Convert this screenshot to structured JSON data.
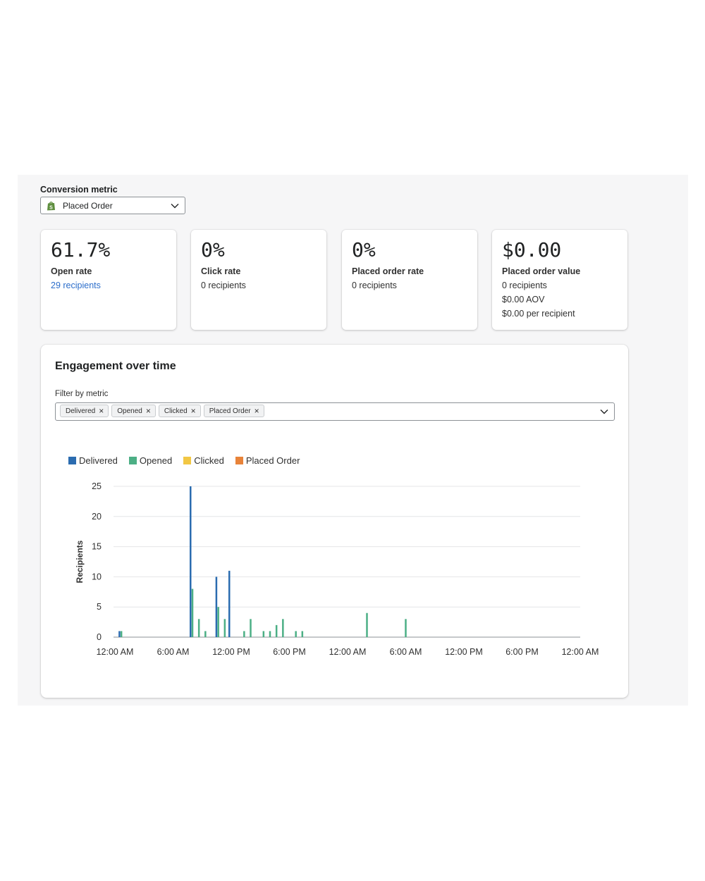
{
  "conversion": {
    "label": "Conversion metric",
    "selected": "Placed Order",
    "icon": "shopify-bag-icon"
  },
  "cards": [
    {
      "value": "61.7%",
      "label": "Open rate",
      "lines": [
        "29 recipients"
      ]
    },
    {
      "value": "0%",
      "label": "Click rate",
      "lines": [
        "0 recipients"
      ]
    },
    {
      "value": "0%",
      "label": "Placed order rate",
      "lines": [
        "0 recipients"
      ]
    },
    {
      "value": "$0.00",
      "label": "Placed order value",
      "lines": [
        "0 recipients",
        "$0.00 AOV",
        "$0.00 per recipient"
      ]
    }
  ],
  "engagement": {
    "title": "Engagement over time",
    "filter_label": "Filter by metric",
    "tags": [
      "Delivered",
      "Opened",
      "Clicked",
      "Placed Order"
    ]
  },
  "colors": {
    "delivered": "#2b6cb0",
    "opened": "#4caf85",
    "clicked": "#f2c744",
    "placed_order": "#e8833a",
    "link": "#2c6ecb"
  },
  "chart_data": {
    "type": "bar",
    "ylabel": "Recipients",
    "ylim": [
      0,
      25
    ],
    "yticks": [
      0,
      5,
      10,
      15,
      20,
      25
    ],
    "xtick_labels": [
      "12:00 AM",
      "6:00 AM",
      "12:00 PM",
      "6:00 PM",
      "12:00 AM",
      "6:00 AM",
      "12:00 PM",
      "6:00 PM",
      "12:00 AM"
    ],
    "xrange_hours": [
      0,
      72
    ],
    "x_unit": "hours",
    "grid": true,
    "legend_position": "top-left",
    "series": [
      {
        "name": "Delivered",
        "color": "#2b6cb0",
        "points": [
          [
            0.7,
            1
          ],
          [
            11.7,
            25
          ],
          [
            15.7,
            10
          ],
          [
            17.7,
            11
          ]
        ]
      },
      {
        "name": "Opened",
        "color": "#4caf85",
        "points": [
          [
            1.0,
            1
          ],
          [
            12.0,
            8
          ],
          [
            13.0,
            3
          ],
          [
            14.0,
            1
          ],
          [
            16.0,
            5
          ],
          [
            17.0,
            3
          ],
          [
            20.0,
            1
          ],
          [
            21.0,
            3
          ],
          [
            23.0,
            1
          ],
          [
            24.0,
            1
          ],
          [
            25.0,
            2
          ],
          [
            26.0,
            3
          ],
          [
            28.0,
            1
          ],
          [
            29.0,
            1
          ],
          [
            39.0,
            4
          ],
          [
            45.0,
            3
          ]
        ]
      },
      {
        "name": "Clicked",
        "color": "#f2c744",
        "points": []
      },
      {
        "name": "Placed Order",
        "color": "#e8833a",
        "points": []
      }
    ]
  }
}
